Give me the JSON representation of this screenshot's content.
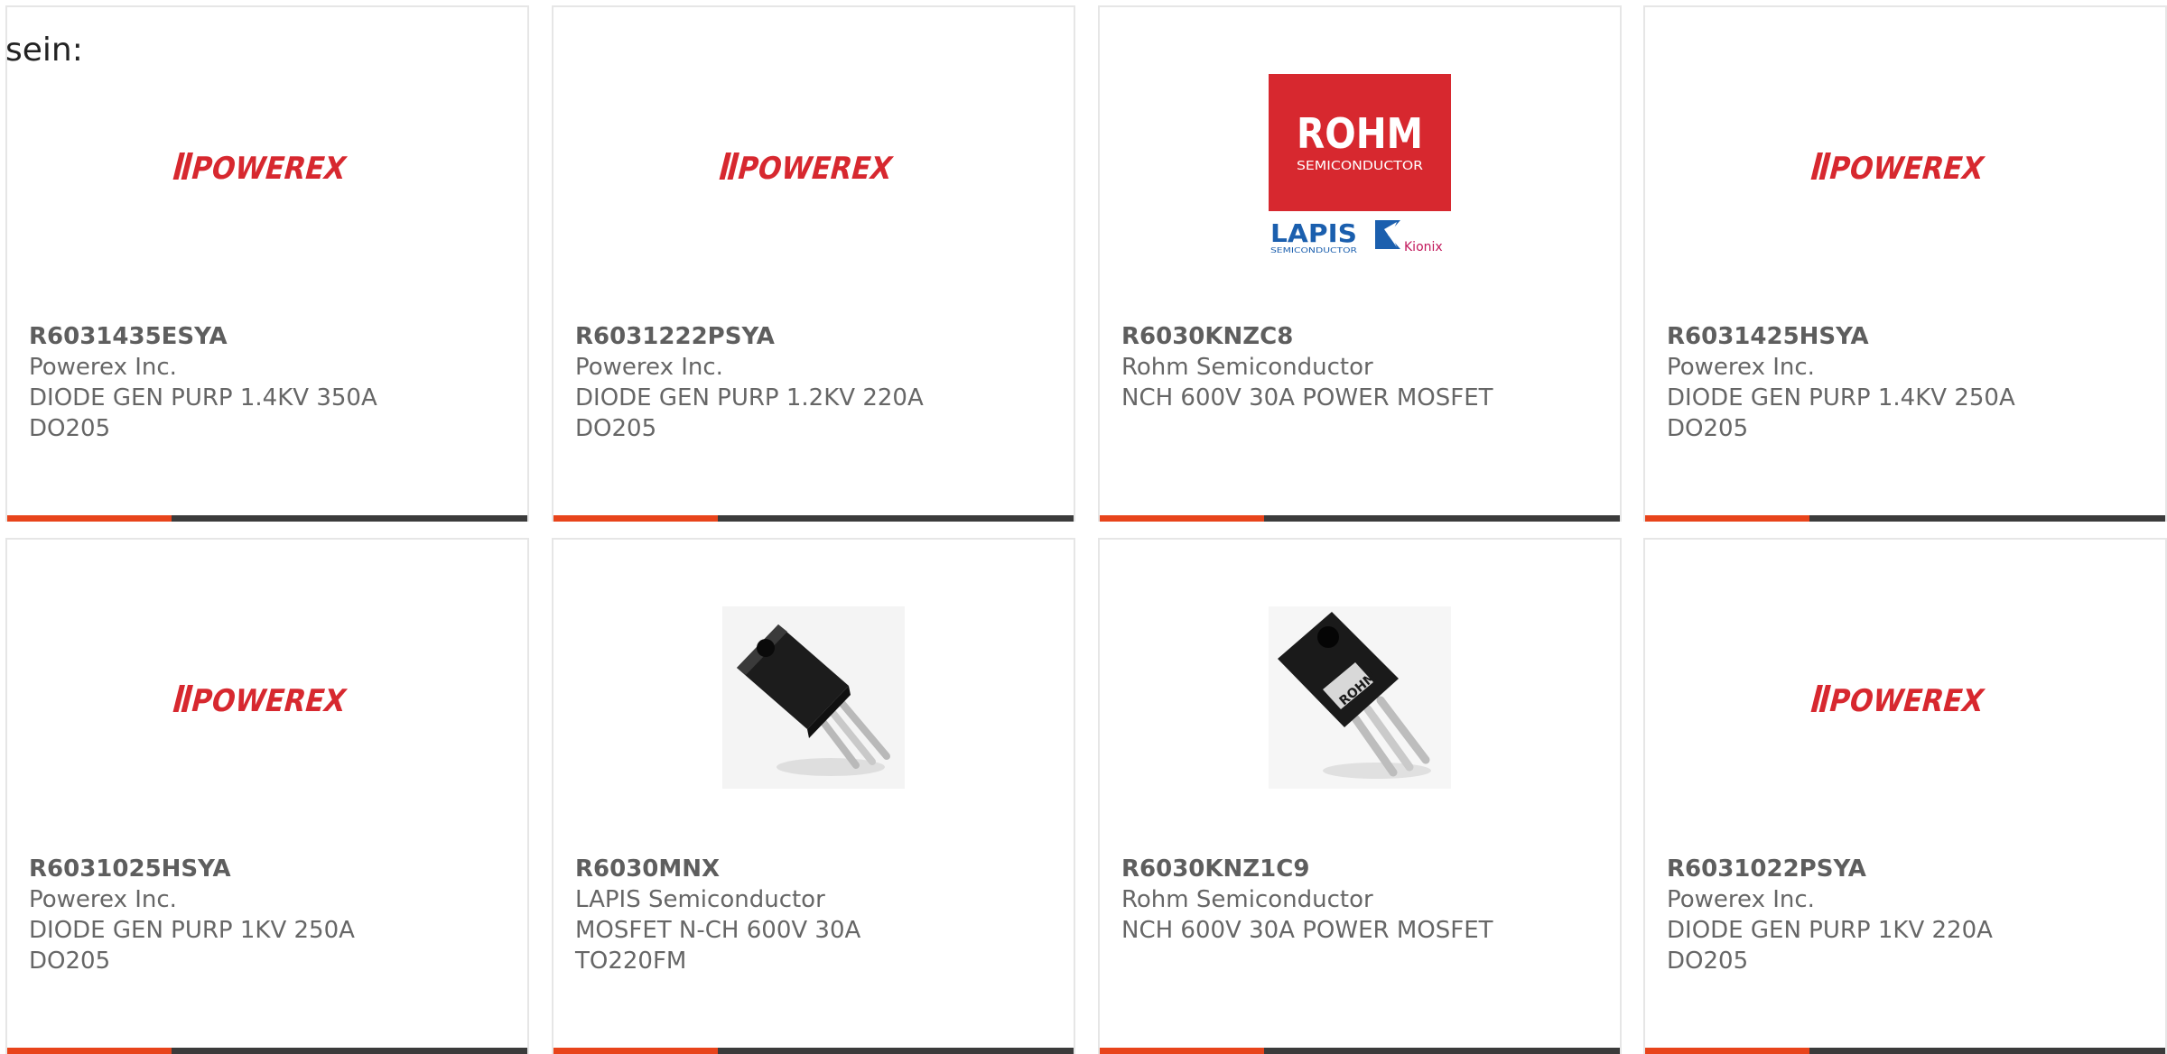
{
  "intro_text": "sein:",
  "colors": {
    "accent": "#e8441b",
    "bar_dark": "#3b3b3b",
    "brand_red": "#d7282f",
    "card_border": "#e6e6e6"
  },
  "logos": {
    "powerex": "POWEREX",
    "rohm_main": "ROHM",
    "rohm_sub": "SEMICONDUCTOR",
    "lapis": "LAPIS",
    "lapis_sub": "SEMICONDUCTOR",
    "kionix": "Kionix"
  },
  "products": [
    {
      "part_number": "R6031435ESYA",
      "manufacturer": "Powerex Inc.",
      "desc1": "DIODE GEN PURP 1.4KV 350A",
      "desc2": "DO205",
      "image": "powerex-logo"
    },
    {
      "part_number": "R6031222PSYA",
      "manufacturer": "Powerex Inc.",
      "desc1": "DIODE GEN PURP 1.2KV 220A",
      "desc2": "DO205",
      "image": "powerex-logo"
    },
    {
      "part_number": "R6030KNZC8",
      "manufacturer": "Rohm Semiconductor",
      "desc1": "NCH 600V 30A POWER MOSFET",
      "desc2": "",
      "image": "rohm-logo"
    },
    {
      "part_number": "R6031425HSYA",
      "manufacturer": "Powerex Inc.",
      "desc1": "DIODE GEN PURP 1.4KV 250A",
      "desc2": "DO205",
      "image": "powerex-logo"
    },
    {
      "part_number": "R6031025HSYA",
      "manufacturer": "Powerex Inc.",
      "desc1": "DIODE GEN PURP 1KV 250A",
      "desc2": "DO205",
      "image": "powerex-logo"
    },
    {
      "part_number": "R6030MNX",
      "manufacturer": "LAPIS Semiconductor",
      "desc1": "MOSFET N-CH 600V 30A",
      "desc2": "TO220FM",
      "image": "to220fm-photo"
    },
    {
      "part_number": "R6030KNZ1C9",
      "manufacturer": "Rohm Semiconductor",
      "desc1": "NCH 600V 30A POWER MOSFET",
      "desc2": "",
      "image": "to247-photo"
    },
    {
      "part_number": "R6031022PSYA",
      "manufacturer": "Powerex Inc.",
      "desc1": "DIODE GEN PURP 1KV 220A",
      "desc2": "DO205",
      "image": "powerex-logo"
    }
  ]
}
